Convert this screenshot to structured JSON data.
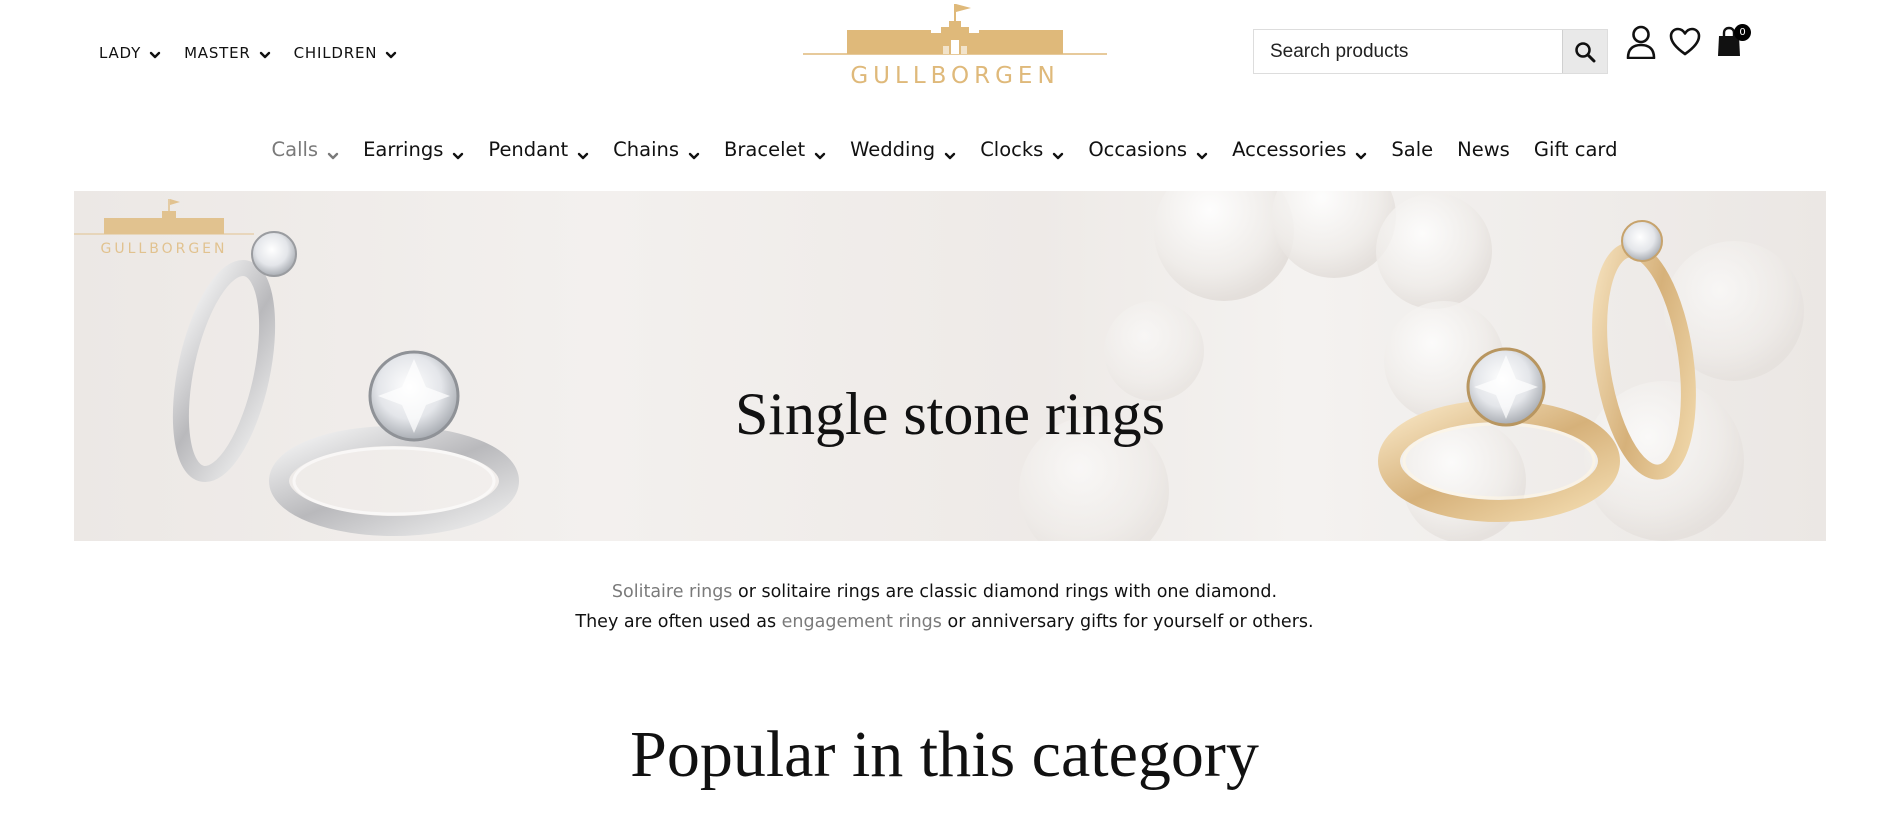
{
  "top_nav": [
    {
      "label": "LADY"
    },
    {
      "label": "MASTER"
    },
    {
      "label": "CHILDREN"
    }
  ],
  "logo": {
    "text": "GULLBORGEN",
    "color": "#dfb97a"
  },
  "search": {
    "placeholder": "Search products"
  },
  "cart": {
    "count": "0"
  },
  "main_nav": [
    {
      "label": "Calls",
      "dropdown": true,
      "active": true
    },
    {
      "label": "Earrings",
      "dropdown": true
    },
    {
      "label": "Pendant",
      "dropdown": true
    },
    {
      "label": "Chains",
      "dropdown": true
    },
    {
      "label": "Bracelet",
      "dropdown": true
    },
    {
      "label": "Wedding",
      "dropdown": true
    },
    {
      "label": "Clocks",
      "dropdown": true
    },
    {
      "label": "Occasions",
      "dropdown": true
    },
    {
      "label": "Accessories",
      "dropdown": true
    },
    {
      "label": "Sale",
      "dropdown": false
    },
    {
      "label": "News",
      "dropdown": false
    },
    {
      "label": "Gift card",
      "dropdown": false
    }
  ],
  "hero": {
    "title": "Single stone rings",
    "watermark": "GULLBORGEN"
  },
  "intro": {
    "link1": "Solitaire rings",
    "text1": " or solitaire rings are classic diamond rings with one diamond.",
    "text2": "They are often used as ",
    "link2": "engagement rings",
    "text3": " or anniversary gifts for yourself or others."
  },
  "section_title": "Popular in this category",
  "colors": {
    "accent": "#dfb97a",
    "link": "#7a7a7a"
  }
}
